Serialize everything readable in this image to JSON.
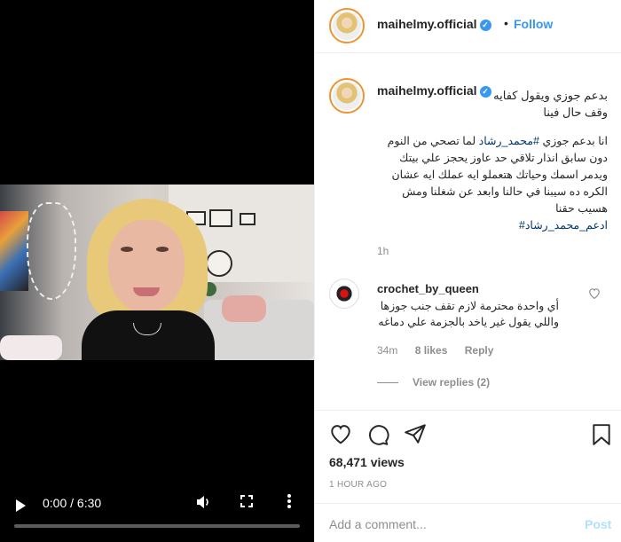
{
  "video": {
    "time_display": "0:00 / 6:30",
    "progress": 0,
    "icons": [
      "play-icon",
      "volume-icon",
      "fullscreen-icon",
      "more-options-icon"
    ]
  },
  "header": {
    "username": "maihelmy.official",
    "separator": "•",
    "follow_label": "Follow"
  },
  "caption": {
    "username": "maihelmy.official",
    "headline": "بدعم جوزي ويقول كفايه وقف حال فينا",
    "body_before_tag": "انا بدعم جوزي ",
    "body_tag": "#محمد_رشاد",
    "body_after_tag": " لما تصحي من النوم دون سابق انذار تلاقي حد عاوز يحجز علي بيتك ويدمر اسمك وحياتك هتعملو ايه عملك ايه عشان الكره ده سيبنا في حالنا وابعد عن شغلنا ومش هسيب حقنا",
    "end_tag": "ادعم_محمد_رشاد#",
    "time": "1h"
  },
  "comment": {
    "username": "crochet_by_queen",
    "text": "أي واحدة محترمة لازم تقف جنب جوزها واللي يقول غير ياخد بالجزمة علي دماغه",
    "time": "34m",
    "likes": "8 likes",
    "reply_label": "Reply",
    "view_replies": "View replies (2)"
  },
  "actions": {
    "views": "68,471 views",
    "date": "1 HOUR AGO",
    "add_comment_placeholder": "Add a comment...",
    "post_label": "Post"
  },
  "colors": {
    "accent": "#3897f0",
    "post_disabled": "#b2dffc",
    "muted": "#8e8e8e"
  }
}
